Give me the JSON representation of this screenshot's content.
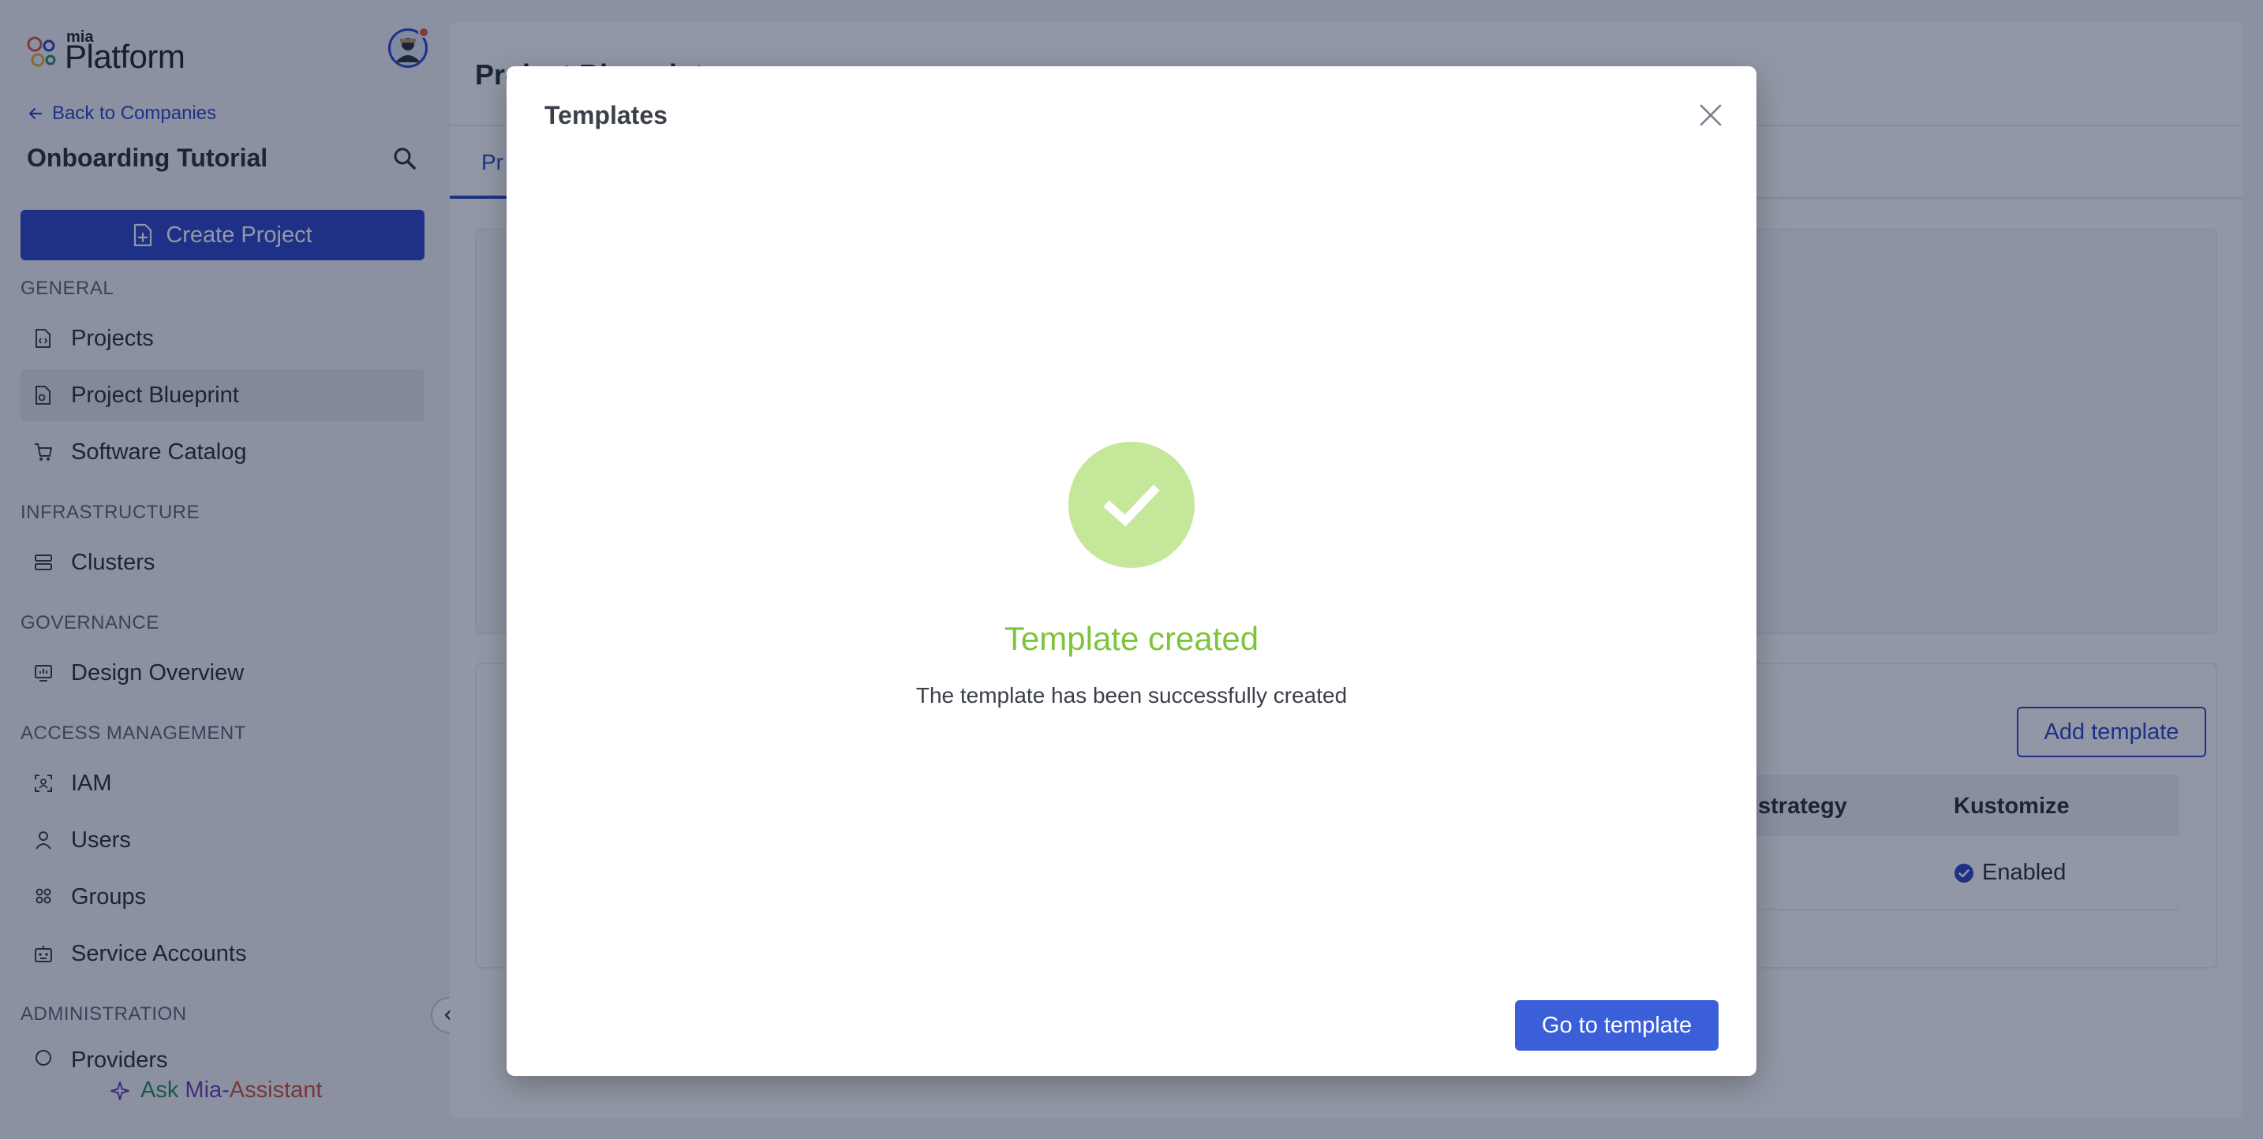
{
  "brand": {
    "small_label": "mia",
    "name": "Platform"
  },
  "sidebar": {
    "back_label": "Back to Companies",
    "company_title": "Onboarding Tutorial",
    "create_project_label": "Create Project",
    "sections": {
      "general": "GENERAL",
      "infrastructure": "INFRASTRUCTURE",
      "governance": "GOVERNANCE",
      "access_management": "ACCESS MANAGEMENT",
      "administration": "ADMINISTRATION"
    },
    "items": {
      "projects": "Projects",
      "project_blueprint": "Project Blueprint",
      "software_catalog": "Software Catalog",
      "clusters": "Clusters",
      "design_overview": "Design Overview",
      "iam": "IAM",
      "users": "Users",
      "groups": "Groups",
      "service_accounts": "Service Accounts",
      "providers": "Providers"
    },
    "active_item": "Project Blueprint",
    "assistant": {
      "ask": "Ask",
      "mia": "Mia-",
      "assistant": "Assistant"
    }
  },
  "main": {
    "page_title": "Project Blueprint",
    "active_tab": "Pr",
    "add_template_label": "Add template",
    "table": {
      "headers": [
        "strategy",
        "Kustomize"
      ],
      "rows": [
        {
          "kustomize": "Enabled"
        }
      ]
    }
  },
  "modal": {
    "title": "Templates",
    "success_title": "Template created",
    "success_message": "The template has been successfully created",
    "primary_button": "Go to template"
  },
  "colors": {
    "brand_blue": "#2e45c7",
    "success_green": "#7ec43b",
    "success_circle": "#c5e79a",
    "primary_button": "#3a5fd9"
  }
}
